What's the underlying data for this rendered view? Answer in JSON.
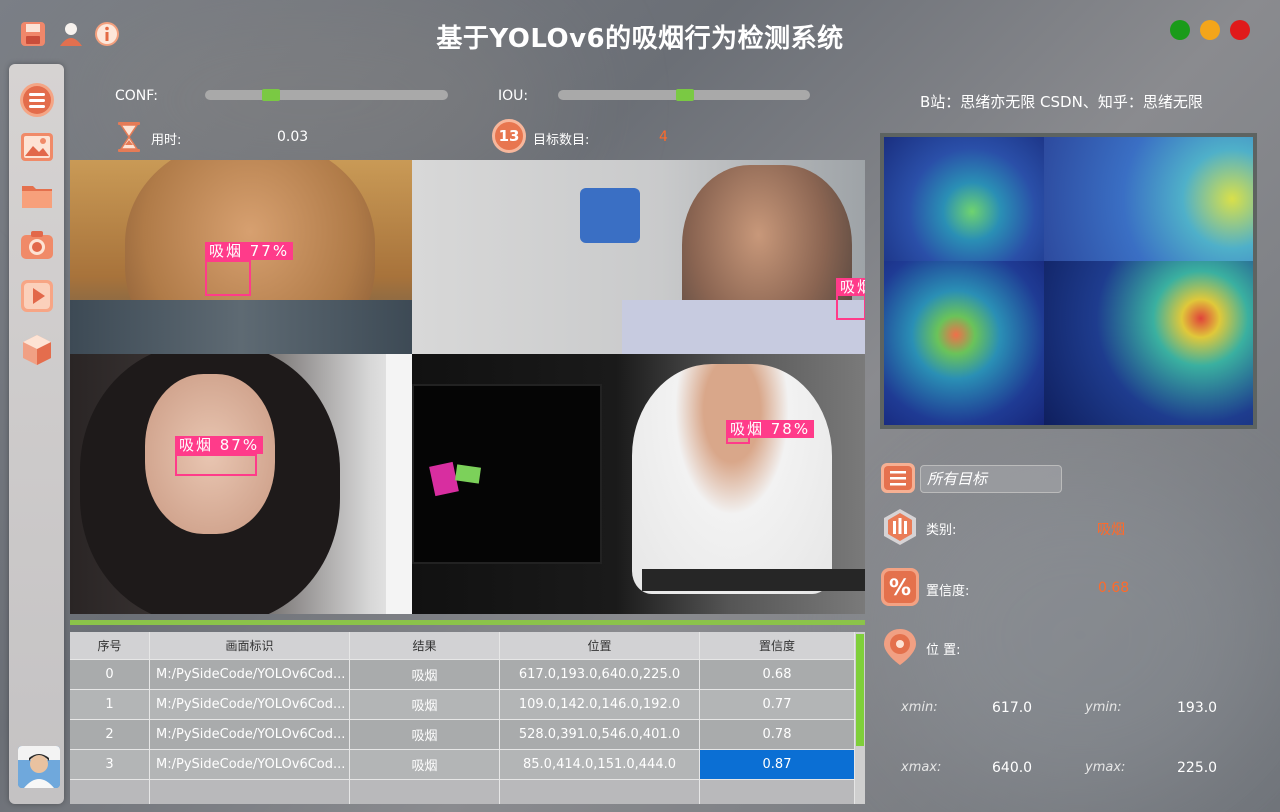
{
  "window": {
    "title": "基于YOLOv6的吸烟行为检测系统",
    "controls": {
      "green": "#1a9b1a",
      "yellow": "#f3a51a",
      "red": "#e01a1a"
    }
  },
  "header": {
    "credit": "B站：思绪亦无限  CSDN、知乎：思绪无限",
    "conf_label": "CONF:",
    "iou_label": "IOU:",
    "conf_value": 0.3,
    "iou_value": 0.5,
    "time_label": "用时:",
    "time_value": "0.03",
    "count_label": "目标数目:",
    "count_value": "4"
  },
  "sidebar": {
    "items": [
      "menu-icon",
      "image-icon",
      "folder-icon",
      "camera-icon",
      "video-icon",
      "model-icon"
    ]
  },
  "detections": [
    {
      "label": "吸烟  77%"
    },
    {
      "label": "吸烟"
    },
    {
      "label": "吸烟  87%"
    },
    {
      "label": "吸烟  78%"
    }
  ],
  "table": {
    "headers": [
      "序号",
      "画面标识",
      "结果",
      "位置",
      "置信度"
    ],
    "rows": [
      [
        "0",
        "M:/PySideCode/YOLOv6Cod...",
        "吸烟",
        "617.0,193.0,640.0,225.0",
        "0.68"
      ],
      [
        "1",
        "M:/PySideCode/YOLOv6Cod...",
        "吸烟",
        "109.0,142.0,146.0,192.0",
        "0.77"
      ],
      [
        "2",
        "M:/PySideCode/YOLOv6Cod...",
        "吸烟",
        "528.0,391.0,546.0,401.0",
        "0.78"
      ],
      [
        "3",
        "M:/PySideCode/YOLOv6Cod...",
        "吸烟",
        "85.0,414.0,151.0,444.0",
        "0.87"
      ]
    ]
  },
  "panel": {
    "target_select": "所有目标",
    "class_label": "类别:",
    "class_value": "吸烟",
    "conf_label": "置信度:",
    "conf_value": "0.68",
    "pos_label": "位 置:",
    "xmin_label": "xmin:",
    "xmin": "617.0",
    "ymin_label": "ymin:",
    "ymin": "193.0",
    "xmax_label": "xmax:",
    "xmax": "640.0",
    "ymax_label": "ymax:",
    "ymax": "225.0"
  }
}
